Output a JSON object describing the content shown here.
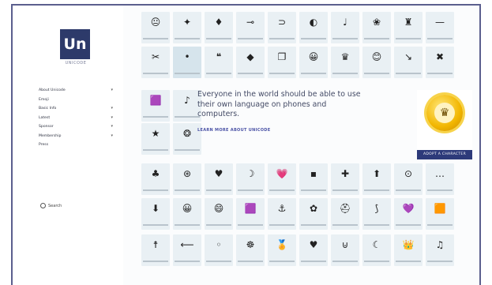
{
  "brand": {
    "logo_text": "Un",
    "logo_sub": "UNICODE"
  },
  "sidebar": {
    "items": [
      {
        "label": "About Unicode",
        "has_chevron": true
      },
      {
        "label": "Emoji",
        "has_chevron": false
      },
      {
        "label": "Basic Info",
        "has_chevron": true
      },
      {
        "label": "Latest",
        "has_chevron": true
      },
      {
        "label": "Sponsor",
        "has_chevron": true
      },
      {
        "label": "Membership",
        "has_chevron": true
      },
      {
        "label": "Press",
        "has_chevron": false
      }
    ],
    "search_label": "Search"
  },
  "promo": {
    "text": "Everyone in the world should be able to use their own language on phones and computers.",
    "link": "LEARN MORE ABOUT UNICODE"
  },
  "adopt": {
    "label": "ADOPT A CHARACTER"
  },
  "grid": {
    "rows": [
      [
        "😐",
        "✦",
        "♦",
        "⊸",
        "⊃",
        "◐",
        "♩",
        "❀",
        "♜",
        "—"
      ],
      [
        "✂",
        "•",
        "❝",
        "◆",
        "❐",
        "😀",
        "♛",
        "😊",
        "↘",
        "✖"
      ],
      [
        "🟪",
        "♪"
      ],
      [
        "★",
        "❂"
      ],
      [
        "♣",
        "⊛",
        "♥",
        "☽",
        "💗",
        "▪",
        "✚",
        "⬆",
        "⊙",
        "…"
      ],
      [
        "⬇",
        "😀",
        "😄",
        "🟪",
        "⚓",
        "✿",
        "⛑",
        "⟆",
        "💜",
        "🟧"
      ],
      [
        "☨",
        "⟵",
        "◦",
        "☸",
        "🏅",
        "♥",
        "⊍",
        "☾",
        "👑",
        "♫"
      ]
    ]
  }
}
